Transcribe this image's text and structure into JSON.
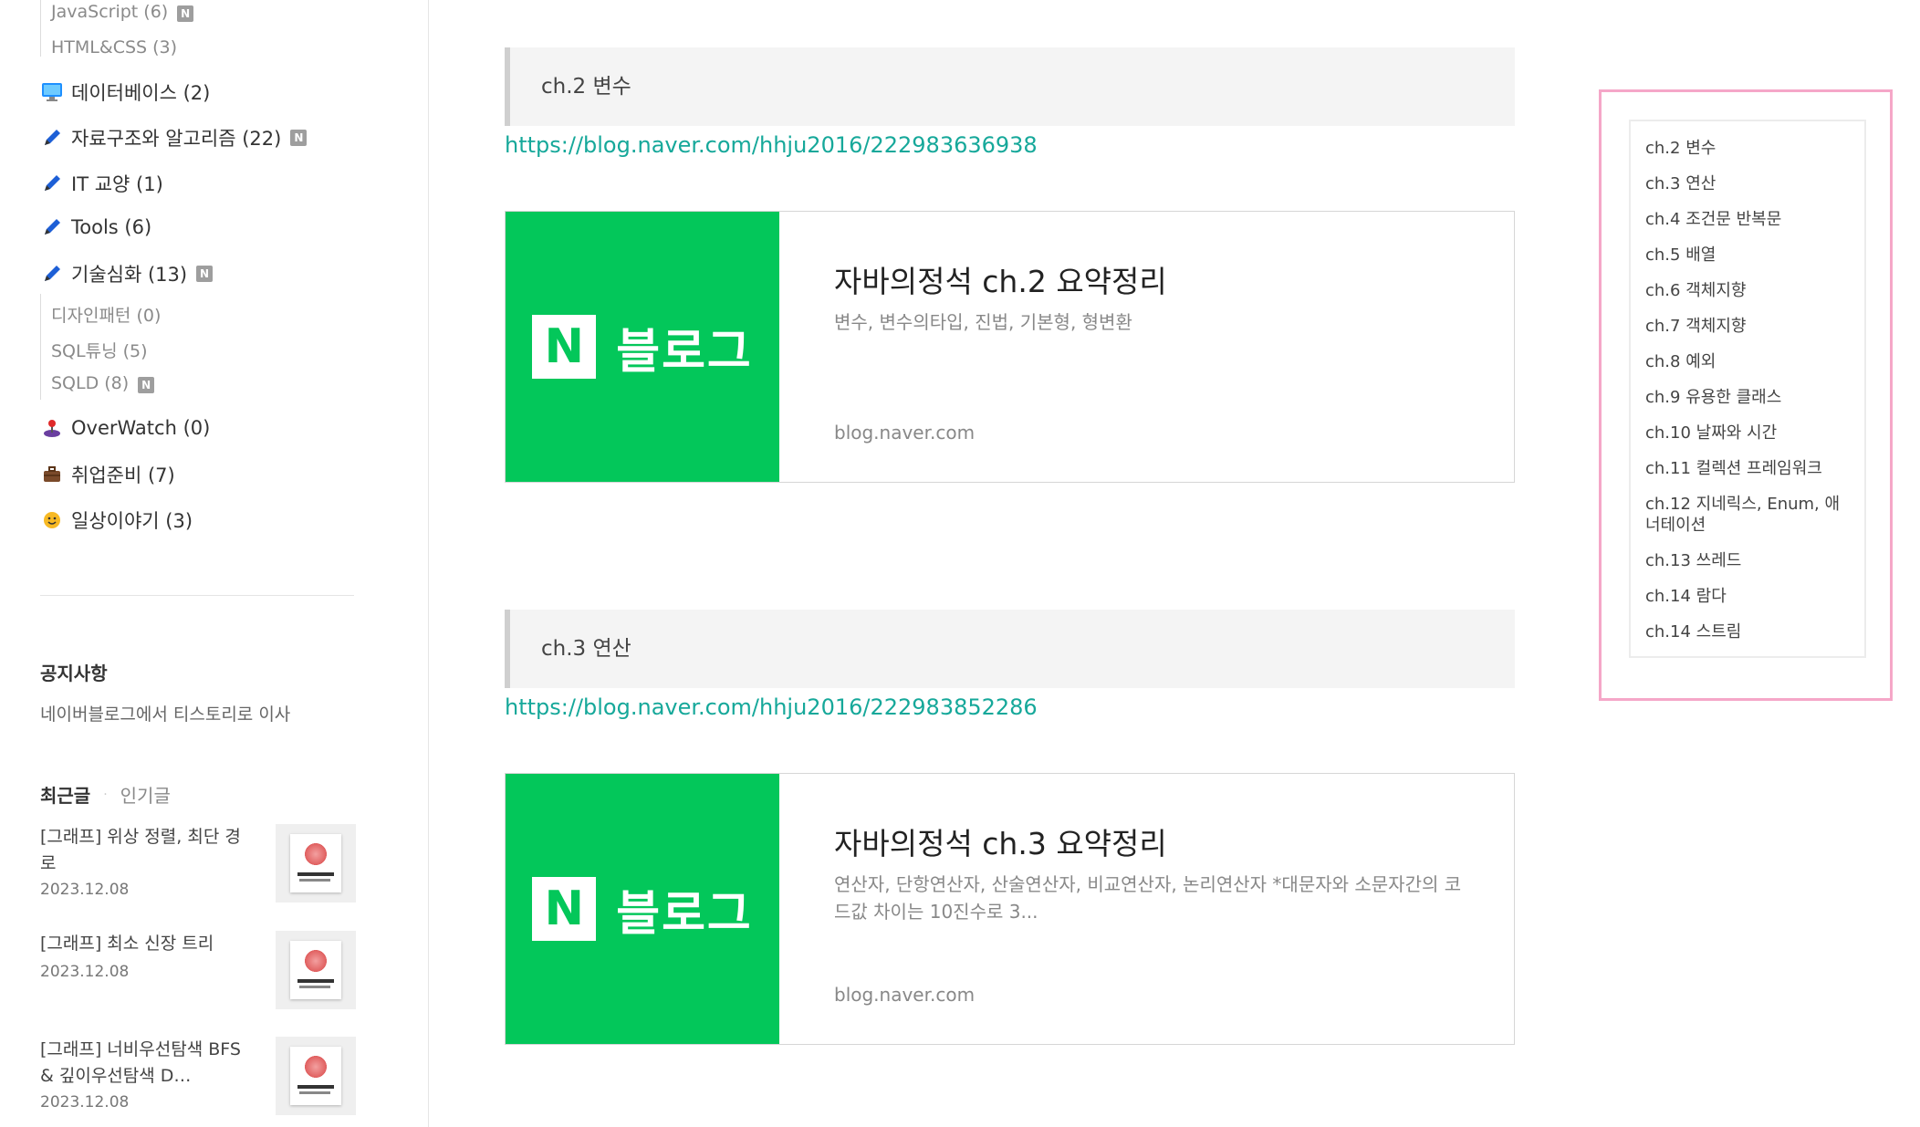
{
  "sidebar": {
    "top_subcategories": [
      {
        "label": "JavaScript (6)",
        "new": true
      },
      {
        "label": "HTML&CSS (3)",
        "new": false
      }
    ],
    "categories": [
      {
        "icon": "monitor-icon",
        "label": "데이터베이스 (2)",
        "new": false
      },
      {
        "icon": "pencil-icon",
        "label": "자료구조와 알고리즘 (22)",
        "new": true
      },
      {
        "icon": "pencil-icon",
        "label": "IT 교양 (1)",
        "new": false
      },
      {
        "icon": "pencil-icon",
        "label": "Tools (6)",
        "new": false
      },
      {
        "icon": "pencil-icon",
        "label": "기술심화 (13)",
        "new": true
      },
      {
        "icon": "joystick-icon",
        "label": "OverWatch (0)",
        "new": false
      },
      {
        "icon": "briefcase-icon",
        "label": "취업준비 (7)",
        "new": false
      },
      {
        "icon": "smiley-icon",
        "label": "일상이야기 (3)",
        "new": false
      }
    ],
    "deep_subcategories": [
      {
        "label": "디자인패턴 (0)",
        "new": false
      },
      {
        "label": "SQL튜닝 (5)",
        "new": false
      },
      {
        "label": "SQLD (8)",
        "new": true
      }
    ],
    "new_badge": "N",
    "notice": {
      "title": "공지사항",
      "item": "네이버블로그에서 티스토리로 이사"
    },
    "post_tabs": {
      "recent": "최근글",
      "popular": "인기글"
    },
    "posts": [
      {
        "title": "[그래프] 위상 정렬, 최단 경로",
        "date": "2023.12.08"
      },
      {
        "title": "[그래프] 최소 신장 트리",
        "date": "2023.12.08"
      },
      {
        "title": "[그래프] 너비우선탐색 BFS & 깊이우선탐색 D…",
        "date": "2023.12.08"
      }
    ]
  },
  "main": {
    "sections": [
      {
        "heading": "ch.2 변수",
        "url": "https://blog.naver.com/hhju2016/222983636938",
        "card": {
          "blog_label": "블로그",
          "logo_letter": "N",
          "title": "자바의정석 ch.2 요약정리",
          "description": "변수, 변수의타입, 진법, 기본형, 형변환",
          "domain": "blog.naver.com"
        }
      },
      {
        "heading": "ch.3 연산",
        "url": "https://blog.naver.com/hhju2016/222983852286",
        "card": {
          "blog_label": "블로그",
          "logo_letter": "N",
          "title": "자바의정석 ch.3 요약정리",
          "description": "연산자, 단항연산자, 산술연산자, 비교연산자, 논리연산자 *대문자와 소문자간의 코드값 차이는 10진수로 3...",
          "domain": "blog.naver.com"
        }
      }
    ]
  },
  "toc": {
    "items": [
      "ch.2 변수",
      "ch.3 연산",
      "ch.4 조건문 반복문",
      "ch.5 배열",
      "ch.6 객체지향",
      "ch.7 객체지향",
      "ch.8 예외",
      "ch.9 유용한 클래스",
      "ch.10 날짜와 시간",
      "ch.11 컬렉션 프레임워크",
      "ch.12 지네릭스, Enum, 애너테이션",
      "ch.13 쓰레드",
      "ch.14 람다",
      "ch.14 스트림"
    ]
  },
  "colors": {
    "link": "#16a89a",
    "naver_green": "#03c75a",
    "toc_border": "#f5a7c8"
  }
}
